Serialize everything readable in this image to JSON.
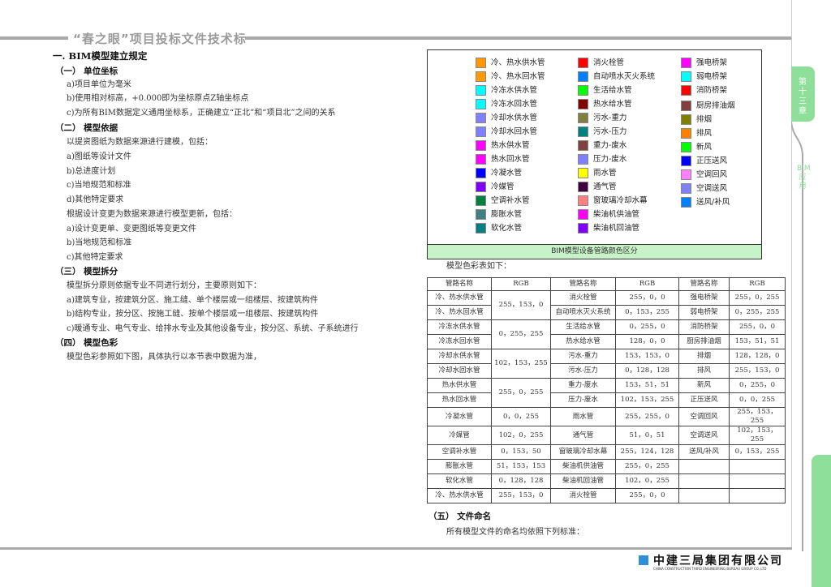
{
  "header": {
    "title": "“春之眼”项目投标文件技术标"
  },
  "side_tab": {
    "chapter": "第十三章",
    "section": "BIM应用"
  },
  "body": {
    "title": "一. BIM模型建立规定",
    "s1": {
      "heading": "（一）  单位坐标",
      "items": [
        "a)项目单位为毫米",
        "b)使用相对标高，+0.000即为坐标原点Z轴坐标点",
        "c)为所有BIM数据定义通用坐标系，正确建立“正北”和“项目北”之间的关系"
      ]
    },
    "s2": {
      "heading": "（二）  模型依据",
      "intro": "以提资图纸为数据来源进行建模，包括：",
      "items": [
        "a)图纸等设计文件",
        "b)总进度计划",
        "c)当地规范和标准",
        "d)其他特定要求"
      ],
      "intro2": "根据设计变更为数据来源进行模型更新，包括：",
      "items2": [
        "a)设计变更单、变更图纸等变更文件",
        "b)当地规范和标准",
        "c)其他特定要求"
      ]
    },
    "s3": {
      "heading": "（三）  模型拆分",
      "intro": "模型拆分原则依据专业不同进行划分，主要原则如下：",
      "items": [
        "a)建筑专业，按建筑分区、施工缝、单个楼层或一组楼层、按建筑构件",
        "b)结构专业，按分区、按施工缝、按单个楼层或一组楼层、按建筑构件",
        "c)暖通专业、电气专业、给排水专业及其他设备专业，按分区、系统、子系统进行"
      ]
    },
    "s4": {
      "heading": "（四）  模型色彩",
      "intro": "模型色彩参照如下图，具体执行以本节表中数据为准，"
    },
    "table_intro": "模型色彩表如下：",
    "s5": {
      "heading": "（五）  文件命名",
      "intro": "所有模型文件的命名均依照下列标准："
    }
  },
  "legend": {
    "caption": "BIM模型设备管路颜色区分",
    "columns": [
      [
        {
          "label": "冷、热水供水管",
          "color": "#ff9900"
        },
        {
          "label": "冷、热水回水管",
          "color": "#ff9900"
        },
        {
          "label": "冷冻水供水管",
          "color": "#00ffff"
        },
        {
          "label": "冷冻水回水管",
          "color": "#00ffff"
        },
        {
          "label": "冷却水供水管",
          "color": "#8080ff"
        },
        {
          "label": "冷却水回水管",
          "color": "#8080ff"
        },
        {
          "label": "热水供水管",
          "color": "#ff00ff"
        },
        {
          "label": "热水回水管",
          "color": "#ff00ff"
        },
        {
          "label": "冷凝水管",
          "color": "#0000ff"
        },
        {
          "label": "冷媒管",
          "color": "#8000ff"
        },
        {
          "label": "空调补水管",
          "color": "#008040"
        },
        {
          "label": "膨胀水管",
          "color": "#408080"
        },
        {
          "label": "软化水管",
          "color": "#008080"
        }
      ],
      [
        {
          "label": "消火栓管",
          "color": "#ff0000"
        },
        {
          "label": "自动喷水灭火系统",
          "color": "#0080ff"
        },
        {
          "label": "生活给水管",
          "color": "#00ff00"
        },
        {
          "label": "热水给水管",
          "color": "#800000"
        },
        {
          "label": "污水-重力",
          "color": "#808040"
        },
        {
          "label": "污水-压力",
          "color": "#008080"
        },
        {
          "label": "重力-废水",
          "color": "#804040"
        },
        {
          "label": "压力-废水",
          "color": "#8080ff"
        },
        {
          "label": "雨水管",
          "color": "#ffff00"
        },
        {
          "label": "通气管",
          "color": "#400040"
        },
        {
          "label": "窗玻璃冷却水幕",
          "color": "#ff8080"
        },
        {
          "label": "柴油机供油管",
          "color": "#ff00ff"
        },
        {
          "label": "柴油机回油管",
          "color": "#8000ff"
        }
      ],
      [
        {
          "label": "强电桥架",
          "color": "#ff00ff"
        },
        {
          "label": "弱电桥架",
          "color": "#00ffff"
        },
        {
          "label": "消防桥架",
          "color": "#ff0000"
        },
        {
          "label": "厨房排油烟",
          "color": "#804040"
        },
        {
          "label": "排烟",
          "color": "#808000"
        },
        {
          "label": "排风",
          "color": "#ff8000"
        },
        {
          "label": "新风",
          "color": "#00ff00"
        },
        {
          "label": "正压送风",
          "color": "#0000ff"
        },
        {
          "label": "空调回风",
          "color": "#ff80ff"
        },
        {
          "label": "空调送风",
          "color": "#8080ff"
        },
        {
          "label": "送风/补风",
          "color": "#0080ff"
        }
      ]
    ]
  },
  "rgb_table": {
    "headers": [
      "管路名称",
      "RGB",
      "管路名称",
      "RGB",
      "管路名称",
      "RGB"
    ],
    "rows": [
      {
        "c": [
          "冷、热水供水管",
          "255，153，0",
          "消火栓管",
          "255，0，0",
          "强电桥架",
          "255，0，255"
        ],
        "span": 2
      },
      {
        "c": [
          "冷、热水回水管",
          null,
          "自动喷水灭火系统",
          "0，153，255",
          "弱电桥架",
          "0，255，255"
        ]
      },
      {
        "c": [
          "冷冻水供水管",
          "0，255，255",
          "生活给水管",
          "0，255，0",
          "消防桥架",
          "255，0，0"
        ],
        "span": 2
      },
      {
        "c": [
          "冷冻水回水管",
          null,
          "热水给水管",
          "128，0，0",
          "厨房排油烟",
          "153，51，51"
        ]
      },
      {
        "c": [
          "冷却水供水管",
          "102，153，255",
          "污水-重力",
          "153，153，0",
          "排烟",
          "128，128，0"
        ],
        "span": 2
      },
      {
        "c": [
          "冷却水回水管",
          null,
          "污水-压力",
          "0，128，128",
          "排风",
          "255，153，0"
        ]
      },
      {
        "c": [
          "热水供水管",
          "255，0，255",
          "重力-废水",
          "153，51，51",
          "新风",
          "0，255，0"
        ],
        "span": 2
      },
      {
        "c": [
          "热水回水管",
          null,
          "压力-废水",
          "102，153，255",
          "正压送风",
          "0，0，255"
        ]
      },
      {
        "c": [
          "冷凝水管",
          "0，0，255",
          "雨水管",
          "255，255，0",
          "空调回风",
          "255，153，255"
        ]
      },
      {
        "c": [
          "冷媒管",
          "102，0，255",
          "通气管",
          "51，0，51",
          "空调送风",
          "102，153，255"
        ]
      },
      {
        "c": [
          "空调补水管",
          "0，153，50",
          "窗玻璃冷却水幕",
          "255，124，128",
          "送风/补风",
          "0，153，255"
        ]
      },
      {
        "c": [
          "膨胀水管",
          "51，153，153",
          "柴油机供油管",
          "255，0，255",
          "",
          ""
        ]
      },
      {
        "c": [
          "软化水管",
          "0，128，128",
          "柴油机回油管",
          "102，0，255",
          "",
          ""
        ]
      },
      {
        "c": [
          "冷、热水供水管",
          "255，153，0",
          "消火栓管",
          "255，0，0",
          "",
          ""
        ]
      }
    ]
  },
  "footer": {
    "company": "中建三局集团有限公司",
    "company_en": "CHINA CONSTRUCTION THIRD ENGINEERING BUREAU GROUP CO.,LTD"
  }
}
